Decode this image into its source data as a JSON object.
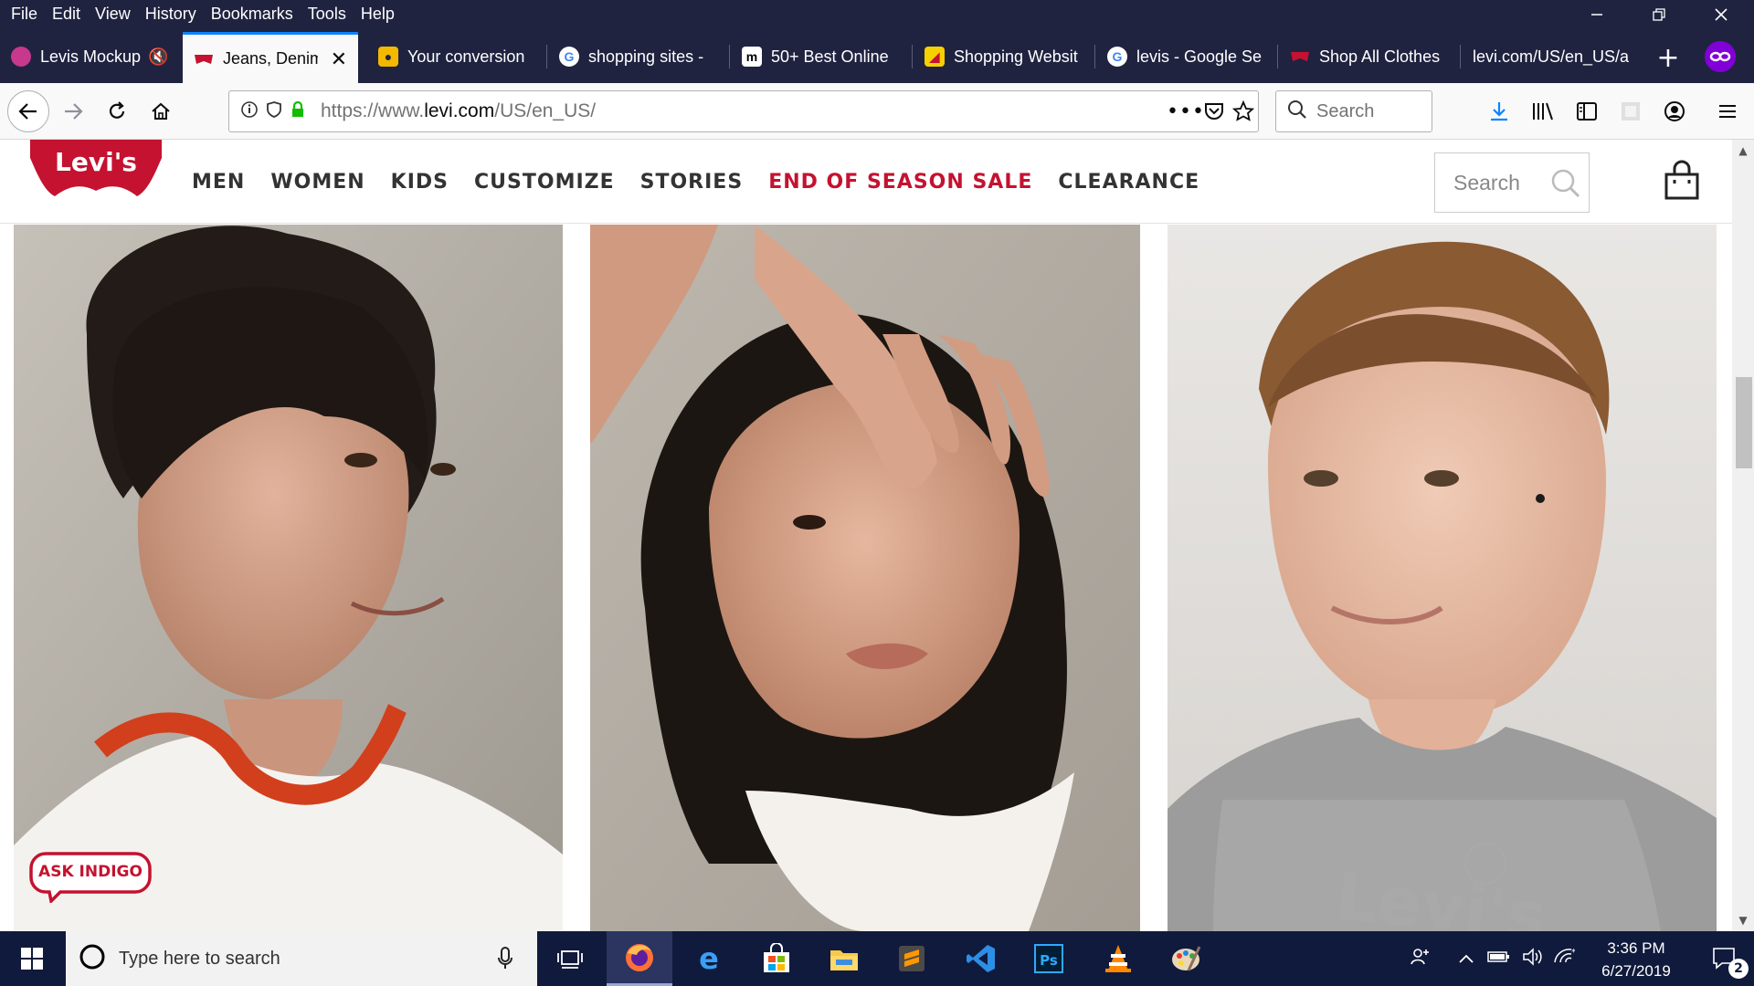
{
  "menubar": [
    "File",
    "Edit",
    "View",
    "History",
    "Bookmarks",
    "Tools",
    "Help"
  ],
  "tabs": [
    {
      "title": "Levis Mockup",
      "active": false
    },
    {
      "title": "Jeans, Denim",
      "active": true
    },
    {
      "title": "Your conversion",
      "active": false
    },
    {
      "title": "shopping sites -",
      "active": false
    },
    {
      "title": "50+ Best Online",
      "active": false
    },
    {
      "title": "Shopping Websit",
      "active": false
    },
    {
      "title": "levis - Google Se",
      "active": false
    },
    {
      "title": "Shop All Clothes",
      "active": false
    },
    {
      "title": "levi.com/US/en_US/a",
      "active": false
    }
  ],
  "urlbar": {
    "prefix": "https://www.",
    "domain": "levi.com",
    "path": "/US/en_US/"
  },
  "browser_search": {
    "placeholder": "Search"
  },
  "site": {
    "logo_text": "Levi's",
    "nav": [
      "MEN",
      "WOMEN",
      "KIDS",
      "CUSTOMIZE",
      "STORIES",
      "END OF SEASON SALE",
      "CLEARANCE"
    ],
    "search_placeholder": "Search",
    "ask_indigo": "ASK INDIGO",
    "sale_color": "#c41230",
    "logo_color": "#c41230"
  },
  "taskbar": {
    "search_placeholder": "Type here to search",
    "time": "3:36 PM",
    "date": "6/27/2019",
    "notification_count": "2"
  }
}
